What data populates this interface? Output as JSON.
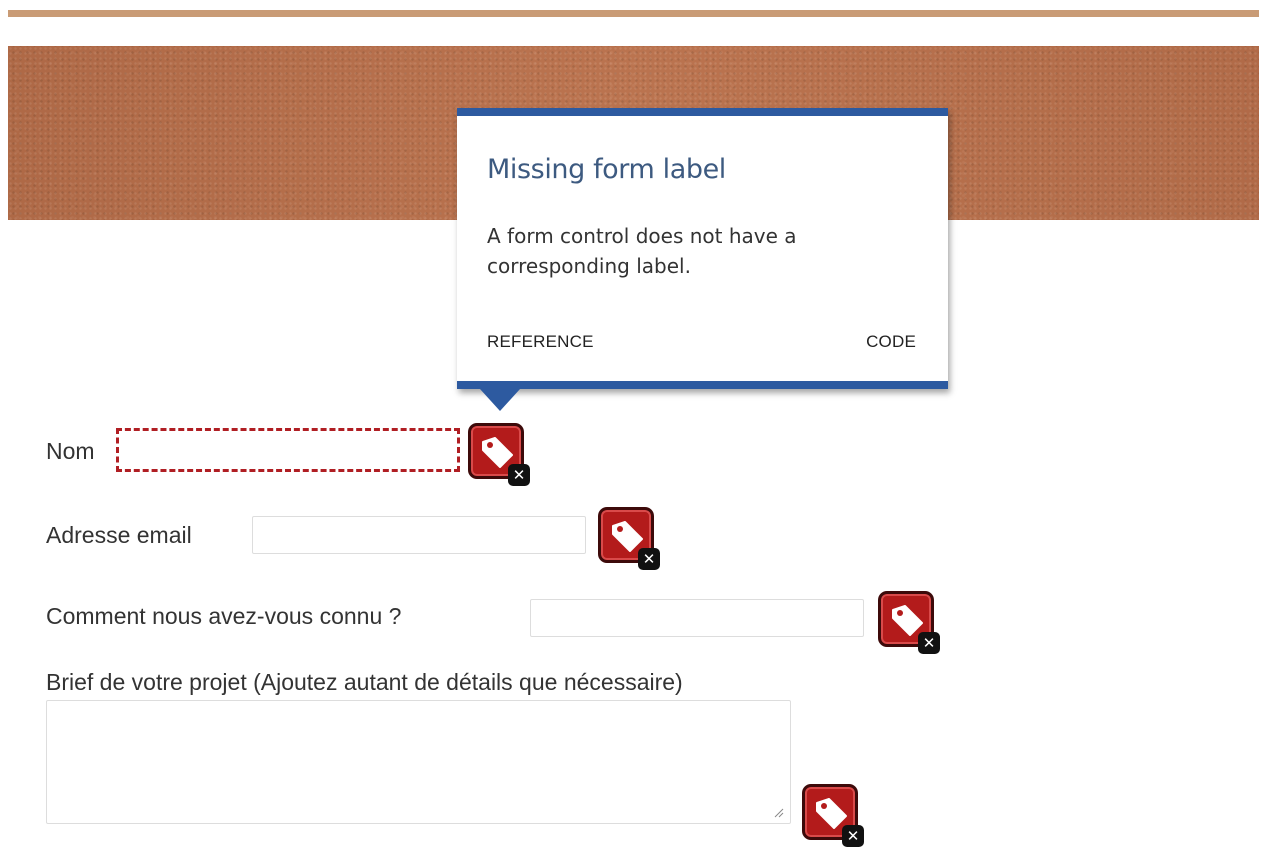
{
  "tooltip": {
    "title": "Missing form label",
    "body": "A form control does not have a corresponding label.",
    "reference_label": "REFERENCE",
    "code_label": "CODE"
  },
  "form": {
    "nom_label": "Nom",
    "email_label": "Adresse email",
    "source_label": "Comment nous avez-vous connu ?",
    "brief_label": "Brief de votre projet (Ajoutez autant de détails que nécessaire)",
    "badge_close_glyph": "✕"
  },
  "colors": {
    "banner": "#b8704c",
    "top_stripe": "#c99b75",
    "tooltip_accent": "#2d5aa0",
    "tooltip_title": "#3d5a80",
    "error_border": "#b01e23",
    "badge_fill": "#b31b1b"
  },
  "icons": {
    "badge": "tag-icon",
    "badge_close": "close-icon"
  }
}
